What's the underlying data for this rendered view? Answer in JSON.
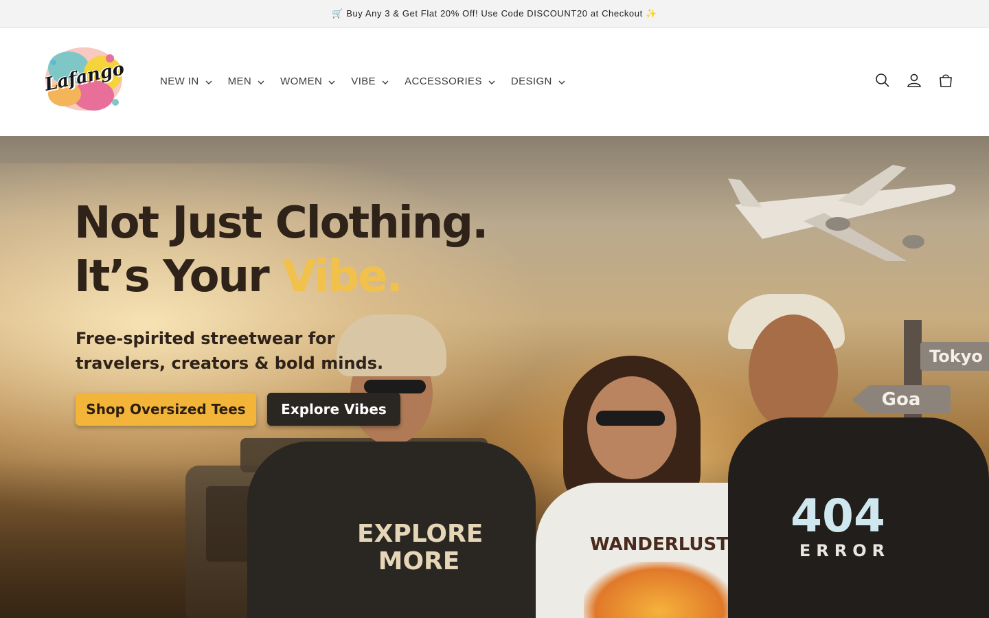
{
  "announcement": {
    "text": "🛒 Buy Any 3 & Get Flat 20% Off! Use Code DISCOUNT20 at Checkout ✨"
  },
  "header": {
    "logo_text": "Lafango",
    "nav": [
      {
        "label": "NEW IN"
      },
      {
        "label": "MEN"
      },
      {
        "label": "WOMEN"
      },
      {
        "label": "VIBE"
      },
      {
        "label": "ACCESSORIES"
      },
      {
        "label": "DESIGN"
      }
    ],
    "icons": [
      "search-icon",
      "account-icon",
      "cart-icon"
    ]
  },
  "hero": {
    "headline_line1": "Not Just Clothing.",
    "headline_line2_prefix": "It’s Your ",
    "headline_line2_accent": "Vibe.",
    "subtitle": "Free-spirited streetwear for travelers, creators & bold minds.",
    "primary_cta": "Shop Oversized Tees",
    "secondary_cta": "Explore Vibes",
    "signs": {
      "tokyo": "Tokyo",
      "goa": "Goa"
    },
    "shirts": {
      "left": "EXPLORE MORE",
      "middle": "WANDERLUST",
      "right_number": "404",
      "right_word": "ERROR"
    }
  },
  "colors": {
    "accent": "#f2c14b",
    "primary_button": "#f2b53a",
    "secondary_button": "#2a2622",
    "announcement_bg": "#f3f3f3"
  }
}
